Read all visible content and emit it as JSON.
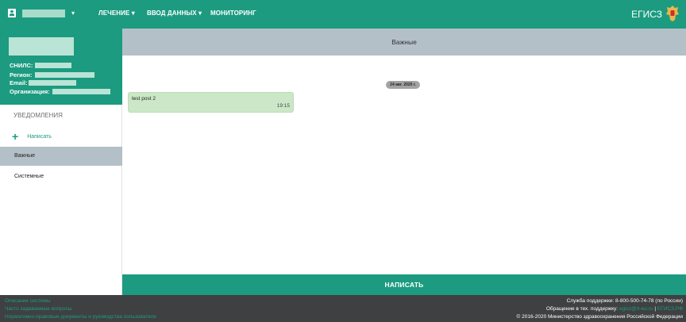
{
  "topbar": {
    "user_menu_caret": "▾",
    "nav": [
      {
        "label": "ЛЕЧЕНИЕ ▾"
      },
      {
        "label": "ВВОД ДАННЫХ ▾"
      },
      {
        "label": "МОНИТОРИНГ"
      }
    ],
    "brand": "ЕГИСЗ"
  },
  "profile": {
    "snils_label": "СНИЛС:",
    "region_label": "Регион:",
    "email_label": "Email:",
    "org_label": "Организация:"
  },
  "sidebar": {
    "section_title": "УВЕДОМЛЕНИЯ",
    "write_label": "Написать",
    "items": [
      {
        "label": "Важные",
        "active": true
      },
      {
        "label": "Системные",
        "active": false
      }
    ]
  },
  "main": {
    "header_title": "Важные",
    "date_pill": "24 авг. 2020 г.",
    "messages": [
      {
        "text": "test post 2",
        "time": "19:15"
      }
    ],
    "compose_button": "НАПИСАТЬ"
  },
  "footer": {
    "links": [
      "Описание системы",
      "Часто задаваемые вопросы",
      "Нормативно-правовые документы и руководства пользователя"
    ],
    "support_phone": "Служба поддержки: 8-800-500-74-78 (по России)",
    "support_mail_prefix": "Обращение в тех. поддержку: ",
    "support_mail": "egisz@rt-eu.ru",
    "support_sep": " | ",
    "support_portal": "ЕГИСЗ.РФ",
    "copyright": "© 2016-2020 Министерство здравоохранения Российской Федерации"
  },
  "colors": {
    "brand_green": "#1c9b80",
    "header_gray": "#b4c0c8",
    "footer_dark": "#3f4042",
    "message_bg": "#cbe7c8"
  }
}
